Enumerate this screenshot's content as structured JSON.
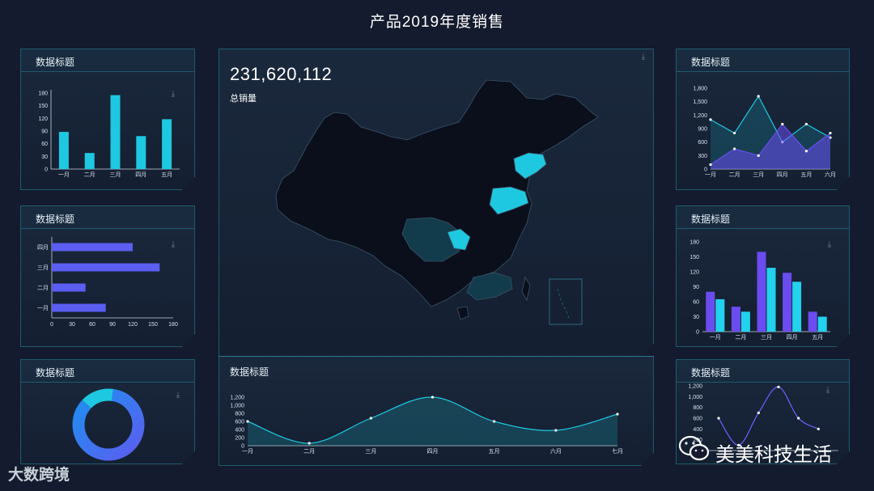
{
  "page": {
    "title": "产品2019年度销售"
  },
  "panels": {
    "p1": {
      "title": "数据标题"
    },
    "p2": {
      "title": "数据标题"
    },
    "p3": {
      "title": "数据标题"
    },
    "p4": {
      "title": "数据标题"
    },
    "p5": {
      "title": "数据标题"
    },
    "p6": {
      "title": "数据标题"
    },
    "bottom": {
      "title": "数据标题"
    }
  },
  "center": {
    "total_value": "231,620,112",
    "total_label": "总销量"
  },
  "watermarks": {
    "left": "大数跨境",
    "right": "美美科技生活"
  },
  "colors": {
    "cyan": "#1ec8e0",
    "purple": "#5b5ef0",
    "violet": "#6a4cf0",
    "teal_fill": "#123c4c",
    "map_land": "#0b0f1c",
    "map_highlight": "#1ec8e0"
  },
  "chart_data": [
    {
      "id": "p1",
      "type": "bar",
      "categories": [
        "一月",
        "二月",
        "三月",
        "四月",
        "五月"
      ],
      "values": [
        88,
        38,
        175,
        78,
        118
      ],
      "yticks": [
        0,
        30,
        60,
        90,
        120,
        150,
        180
      ],
      "ylim": [
        0,
        180
      ]
    },
    {
      "id": "p2",
      "type": "bar",
      "orientation": "horizontal",
      "categories": [
        "一月",
        "二月",
        "三月",
        "四月"
      ],
      "values": [
        80,
        50,
        160,
        120
      ],
      "xticks": [
        0,
        30,
        60,
        90,
        120,
        150,
        180
      ],
      "xlim": [
        0,
        180
      ]
    },
    {
      "id": "p3",
      "type": "pie",
      "subtype": "donut",
      "values": [
        85,
        15
      ]
    },
    {
      "id": "p4",
      "type": "line",
      "categories": [
        "一月",
        "二月",
        "三月",
        "四月",
        "五月",
        "六月"
      ],
      "series": [
        {
          "values": [
            1100,
            800,
            1620,
            600,
            1000,
            700
          ]
        },
        {
          "values": [
            100,
            450,
            300,
            1000,
            400,
            800
          ]
        }
      ],
      "yticks": [
        0,
        300,
        600,
        900,
        1200,
        1500,
        1800
      ],
      "ylim": [
        0,
        1800
      ]
    },
    {
      "id": "p5",
      "type": "bar",
      "categories": [
        "一月",
        "二月",
        "三月",
        "四月",
        "五月"
      ],
      "series": [
        {
          "values": [
            80,
            50,
            160,
            118,
            40
          ]
        },
        {
          "values": [
            65,
            40,
            128,
            100,
            30
          ]
        }
      ],
      "yticks": [
        0,
        30,
        60,
        90,
        120,
        150,
        180
      ],
      "ylim": [
        0,
        180
      ]
    },
    {
      "id": "p6",
      "type": "line",
      "categories": [
        "一月",
        "二月",
        "三月",
        "四月",
        "五月",
        "六月",
        "七月"
      ],
      "series": [
        {
          "values": [
            600,
            100,
            700,
            1180,
            600,
            400
          ]
        }
      ],
      "yticks": [
        0,
        200,
        400,
        600,
        800,
        1000,
        1200
      ],
      "ylim": [
        0,
        1200
      ]
    },
    {
      "id": "bottom",
      "type": "area",
      "categories": [
        "一月",
        "二月",
        "三月",
        "四月",
        "五月",
        "六月",
        "七月"
      ],
      "values": [
        600,
        60,
        680,
        1200,
        600,
        380,
        780
      ],
      "yticks": [
        0,
        200,
        400,
        600,
        800,
        1000,
        1200
      ],
      "ylim": [
        0,
        1200
      ]
    }
  ]
}
